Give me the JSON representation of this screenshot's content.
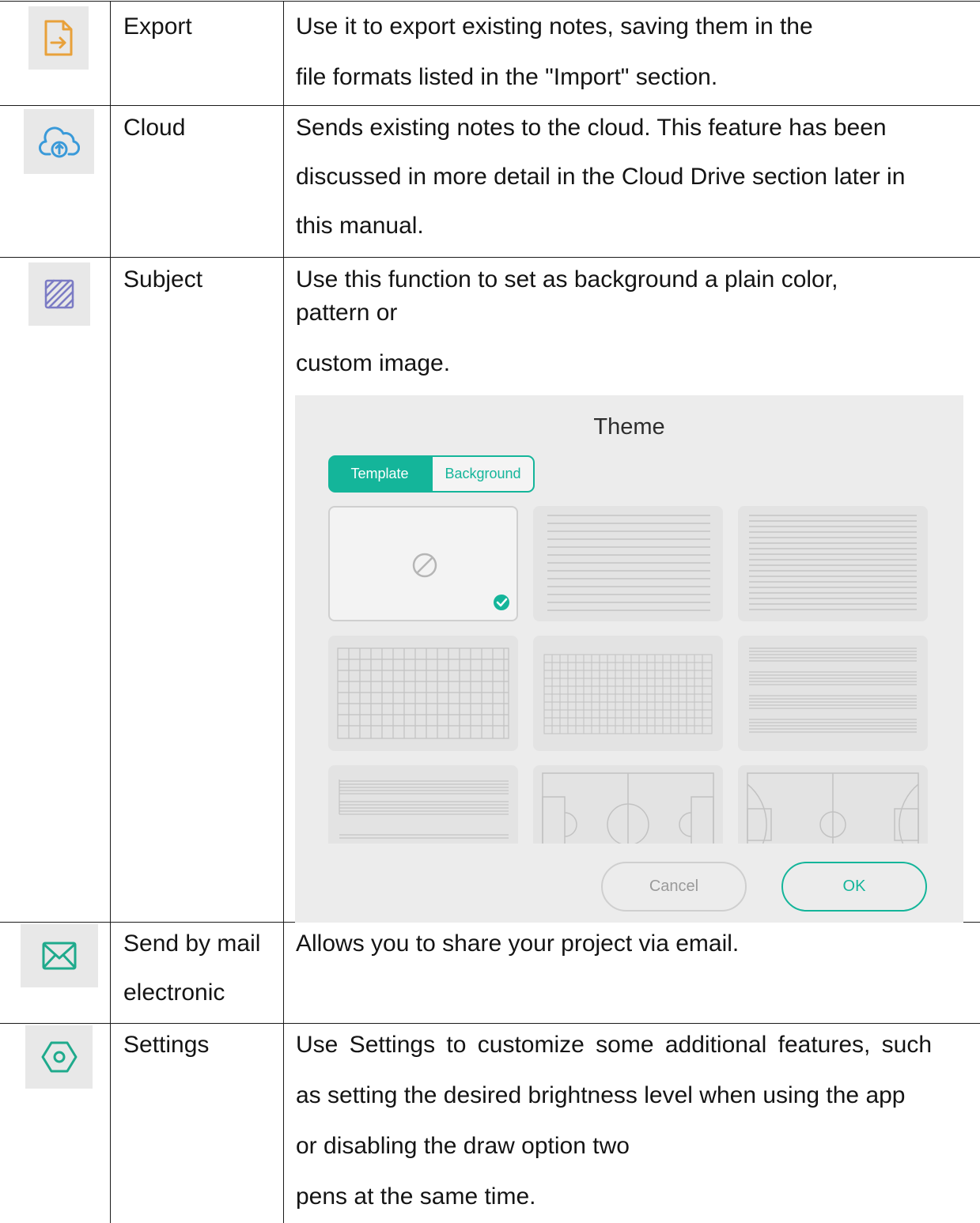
{
  "rows": [
    {
      "icon": "export-icon",
      "name": "Export",
      "desc_lines": [
        "Use it to export existing notes, saving them in the",
        "file formats listed in the \"Import\" section."
      ]
    },
    {
      "icon": "cloud-upload-icon",
      "name": "Cloud",
      "desc_lines": [
        "Sends existing notes to the cloud. This feature has been",
        "discussed in more detail in the Cloud Drive section later in",
        "this manual."
      ]
    },
    {
      "icon": "subject-pattern-icon",
      "name": "Subject",
      "desc_lines": [
        "Use this function to set as background a plain color,",
        "pattern or",
        "custom image."
      ]
    },
    {
      "icon": "mail-icon",
      "name_lines": [
        "Send by mail",
        "electronic"
      ],
      "desc_lines": [
        "Allows you to share your project via email."
      ]
    },
    {
      "icon": "settings-icon",
      "name": "Settings",
      "desc_lines": [
        "Use Settings to customize some additional features, such",
        "as setting the desired brightness level when using the app",
        "or disabling the draw option two",
        "pens at the same time."
      ]
    }
  ],
  "theme_dialog": {
    "title": "Theme",
    "tabs": {
      "template": "Template",
      "background": "Background"
    },
    "active_tab": "Template",
    "selected_template": "blank",
    "templates": [
      "blank",
      "lined",
      "narrow-lined",
      "grid",
      "fine-grid",
      "music-staff",
      "music-staff-grand",
      "football-pitch",
      "basketball-court"
    ],
    "cancel_label": "Cancel",
    "ok_label": "OK",
    "accent_color": "#14b59a"
  },
  "colors": {
    "export_icon": "#e8a13a",
    "cloud_icon": "#3a9ad9",
    "subject_icon": "#7b7bc4",
    "mail_icon": "#1faa8c",
    "settings_icon": "#1faa8c"
  }
}
